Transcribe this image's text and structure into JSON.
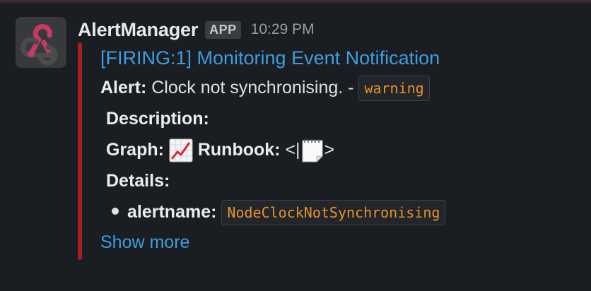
{
  "message": {
    "sender": "AlertManager",
    "badge": "APP",
    "timestamp": "10:29 PM"
  },
  "attachment": {
    "title": "[FIRING:1] Monitoring Event Notification",
    "color": "#a4201d",
    "alert_label": "Alert:",
    "alert_text": "Clock not synchronising. -",
    "severity": "warning",
    "description_label": "Description:",
    "graph_label": "Graph:",
    "graph_icon": "chart-increasing-icon",
    "runbook_label": "Runbook:",
    "runbook_open": "<|",
    "runbook_icon": "notepad-icon",
    "runbook_close": ">",
    "details_label": "Details:",
    "details": [
      {
        "key": "alertname:",
        "value": "NodeClockNotSynchronising"
      }
    ],
    "show_more": "Show more"
  },
  "colors": {
    "background": "#1a1d21",
    "link": "#3d9ee0",
    "code_text": "#e8912d",
    "firing_bar": "#a4201d"
  }
}
